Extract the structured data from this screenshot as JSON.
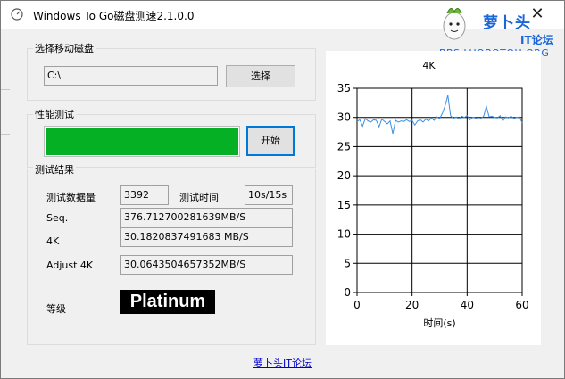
{
  "window": {
    "title": "Windows To Go磁盘测速2.1.0.0",
    "close_glyph": "✕"
  },
  "logo": {
    "name": "萝卜头",
    "sub": "IT论坛",
    "url": "BBS.LUOBOTOU.ORG"
  },
  "select_disk": {
    "group_label": "选择移动磁盘",
    "path_value": "C:\\",
    "select_button": "选择"
  },
  "perf_test": {
    "group_label": "性能测试",
    "progress": 1.0,
    "start_button": "开始"
  },
  "results": {
    "group_label": "测试结果",
    "data_amount_label": "测试数据量",
    "data_amount_value": "3392",
    "test_time_label": "测试时间",
    "test_time_value": "10s/15s",
    "seq_label": "Seq.",
    "seq_value": "376.712700281639MB/S",
    "k4_label": "4K",
    "k4_value": "30.1820837491683 MB/S",
    "adjust_label": "Adjust 4K",
    "adjust_value": "30.0643504657352MB/S",
    "grade_label": "等级",
    "grade_value": "Platinum"
  },
  "footer": {
    "link": "萝卜头IT论坛"
  },
  "colors": {
    "progress_fill": "#06b025",
    "line": "#3d8fe0",
    "accent": "#0078d7"
  },
  "chart_data": {
    "type": "line",
    "title": "4K",
    "xlabel": "时间(s)",
    "ylabel": "",
    "xlim": [
      0,
      60
    ],
    "ylim": [
      0,
      35
    ],
    "xticks": [
      0,
      20,
      40,
      60
    ],
    "yticks": [
      0,
      5,
      10,
      15,
      20,
      25,
      30,
      35
    ],
    "grid": true,
    "series": [
      {
        "name": "",
        "x": [
          0,
          1,
          2,
          3,
          4,
          5,
          6,
          7,
          8,
          9,
          10,
          11,
          12,
          13,
          14,
          15,
          16,
          17,
          18,
          19,
          20,
          21,
          22,
          23,
          24,
          25,
          26,
          27,
          28,
          29,
          30,
          31,
          32,
          33,
          34,
          35,
          36,
          37,
          38,
          39,
          40,
          41,
          42,
          43,
          44,
          45,
          46,
          47,
          48,
          49,
          50,
          51,
          52,
          53,
          54,
          55,
          56,
          57,
          58,
          59,
          60
        ],
        "y": [
          29.3,
          29.6,
          28.5,
          29.8,
          29.4,
          29.2,
          29.6,
          29.5,
          28.4,
          29.7,
          29.3,
          28.9,
          29.4,
          27.2,
          29.5,
          29.2,
          29.4,
          29.3,
          29.6,
          29.3,
          29.5,
          28.7,
          29.4,
          29.6,
          29.2,
          29.7,
          29.4,
          29.9,
          29.5,
          30.1,
          29.8,
          30.7,
          32.0,
          33.8,
          30.3,
          29.8,
          30.1,
          29.7,
          30.2,
          30.0,
          30.3,
          29.6,
          30.0,
          29.9,
          29.7,
          29.8,
          30.2,
          31.9,
          30.1,
          30.2,
          30.0,
          29.9,
          30.3,
          29.4,
          30.1,
          29.9,
          30.2,
          29.8,
          30.0,
          30.1,
          29.1
        ]
      }
    ]
  }
}
